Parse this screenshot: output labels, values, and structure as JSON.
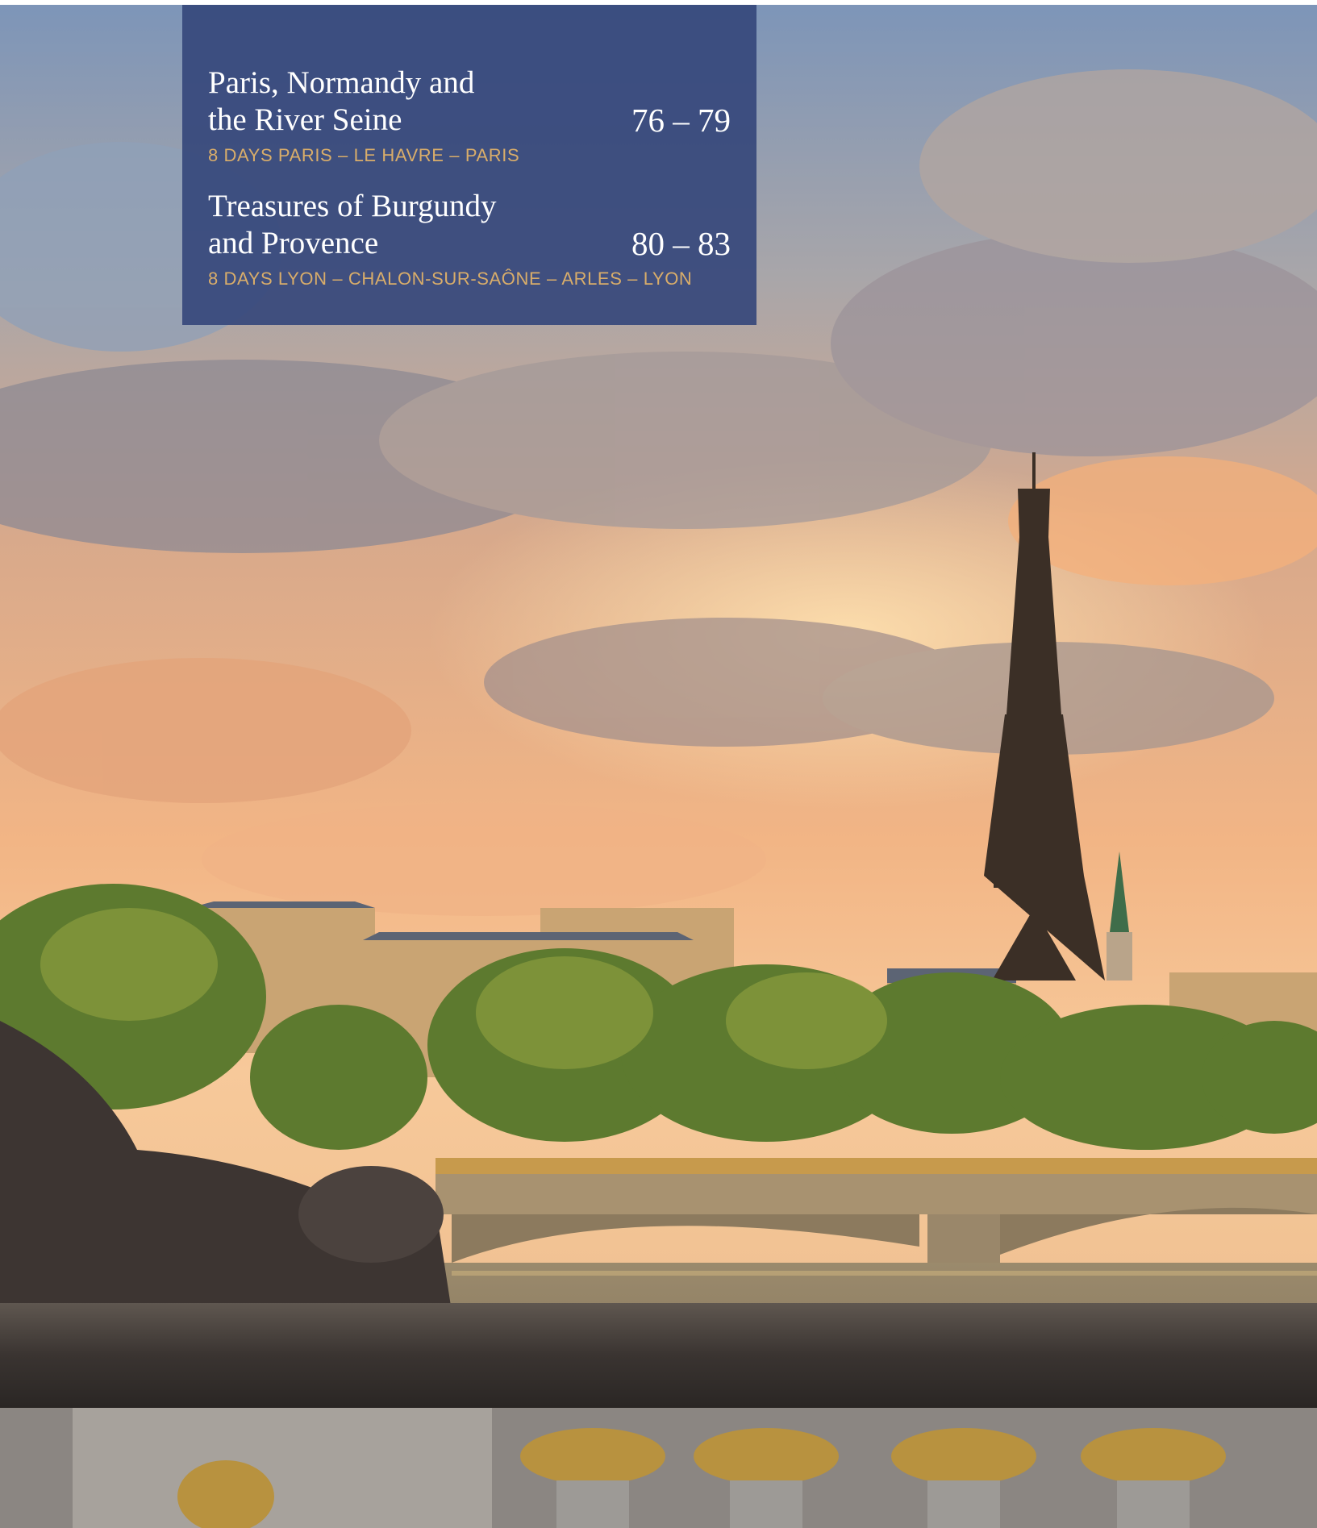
{
  "toc": {
    "entries": [
      {
        "title_line1": "Paris, Normandy and",
        "title_line2": "the River Seine",
        "pages": "76 – 79",
        "route": "8 DAYS PARIS – LE HAVRE – PARIS"
      },
      {
        "title_line1": "Treasures of Burgundy",
        "title_line2": "and Provence",
        "pages": "80 – 83",
        "route": "8 DAYS LYON – CHALON-SUR-SAÔNE – ARLES – LYON"
      }
    ]
  },
  "colors": {
    "panel": "#34467a",
    "route_text": "#d9ad6a",
    "title_text": "#ffffff"
  }
}
